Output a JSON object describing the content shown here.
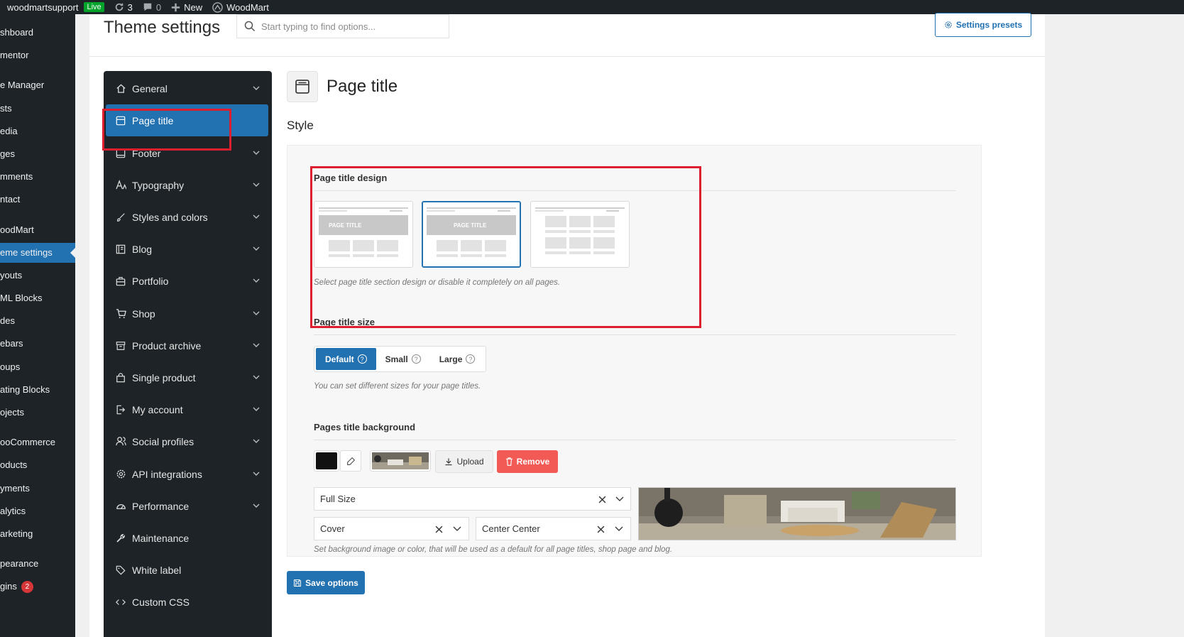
{
  "admin_bar": {
    "site_name": "woodmartsupport",
    "live_badge": "Live",
    "updates_count": "3",
    "comments_count": "0",
    "new_label": "New",
    "woodmart_label": "WoodMart"
  },
  "wp_menu": {
    "items": [
      {
        "label": "shboard",
        "active": false
      },
      {
        "label": "mentor",
        "active": false
      },
      {
        "label": "e Manager",
        "active": false
      },
      {
        "label": "sts",
        "active": false
      },
      {
        "label": "edia",
        "active": false
      },
      {
        "label": "ges",
        "active": false
      },
      {
        "label": "mments",
        "active": false
      },
      {
        "label": "ntact",
        "active": false
      },
      {
        "label": "oodMart",
        "active": false
      },
      {
        "label": "eme settings",
        "active": true
      },
      {
        "label": "youts",
        "active": false
      },
      {
        "label": "ML Blocks",
        "active": false
      },
      {
        "label": "des",
        "active": false
      },
      {
        "label": "ebars",
        "active": false
      },
      {
        "label": "oups",
        "active": false
      },
      {
        "label": "ating Blocks",
        "active": false
      },
      {
        "label": "ojects",
        "active": false
      },
      {
        "label": "ooCommerce",
        "active": false
      },
      {
        "label": "oducts",
        "active": false
      },
      {
        "label": "yments",
        "active": false
      },
      {
        "label": "alytics",
        "active": false
      },
      {
        "label": "arketing",
        "active": false
      },
      {
        "label": "pearance",
        "active": false
      },
      {
        "label": "gins",
        "active": false,
        "badge": "2"
      }
    ]
  },
  "header": {
    "title": "Theme settings",
    "search_placeholder": "Start typing to find options...",
    "presets_label": "Settings presets"
  },
  "ts_nav": {
    "items": [
      {
        "label": "General",
        "icon": "home-icon",
        "active": false,
        "chevron": true
      },
      {
        "label": "Page title",
        "icon": "page-title-icon",
        "active": true,
        "chevron": false
      },
      {
        "label": "Footer",
        "icon": "footer-icon",
        "active": false,
        "chevron": true
      },
      {
        "label": "Typography",
        "icon": "typography-icon",
        "active": false,
        "chevron": true
      },
      {
        "label": "Styles and colors",
        "icon": "brush-icon",
        "active": false,
        "chevron": true
      },
      {
        "label": "Blog",
        "icon": "blog-icon",
        "active": false,
        "chevron": true
      },
      {
        "label": "Portfolio",
        "icon": "briefcase-icon",
        "active": false,
        "chevron": true
      },
      {
        "label": "Shop",
        "icon": "cart-icon",
        "active": false,
        "chevron": true
      },
      {
        "label": "Product archive",
        "icon": "archive-icon",
        "active": false,
        "chevron": true
      },
      {
        "label": "Single product",
        "icon": "bag-icon",
        "active": false,
        "chevron": true
      },
      {
        "label": "My account",
        "icon": "account-icon",
        "active": false,
        "chevron": true
      },
      {
        "label": "Social profiles",
        "icon": "users-icon",
        "active": false,
        "chevron": true
      },
      {
        "label": "API integrations",
        "icon": "gear-icon",
        "active": false,
        "chevron": true
      },
      {
        "label": "Performance",
        "icon": "gauge-icon",
        "active": false,
        "chevron": true
      },
      {
        "label": "Maintenance",
        "icon": "wrench-icon",
        "active": false,
        "chevron": false
      },
      {
        "label": "White label",
        "icon": "tag-icon",
        "active": false,
        "chevron": false
      },
      {
        "label": "Custom CSS",
        "icon": "code-icon",
        "active": false,
        "chevron": false
      }
    ]
  },
  "content": {
    "section_title": "Page title",
    "style_heading": "Style",
    "design": {
      "title": "Page title design",
      "card_text": "PAGE TITLE",
      "selected_index": 1,
      "hint": "Select page title section design or disable it completely on all pages."
    },
    "size": {
      "title": "Page title size",
      "options": [
        "Default",
        "Small",
        "Large"
      ],
      "selected": "Default",
      "hint": "You can set different sizes for your page titles."
    },
    "background": {
      "title": "Pages title background",
      "color": "#111111",
      "upload_label": "Upload",
      "remove_label": "Remove",
      "image_size": "Full Size",
      "bg_size": "Cover",
      "bg_position": "Center Center",
      "hint": "Set background image or color, that will be used as a default for all page titles, shop page and blog."
    },
    "save_label": "Save options"
  },
  "colors": {
    "accent": "#2271b1",
    "remove": "#f15a55",
    "highlight": "#dc1e2e"
  }
}
